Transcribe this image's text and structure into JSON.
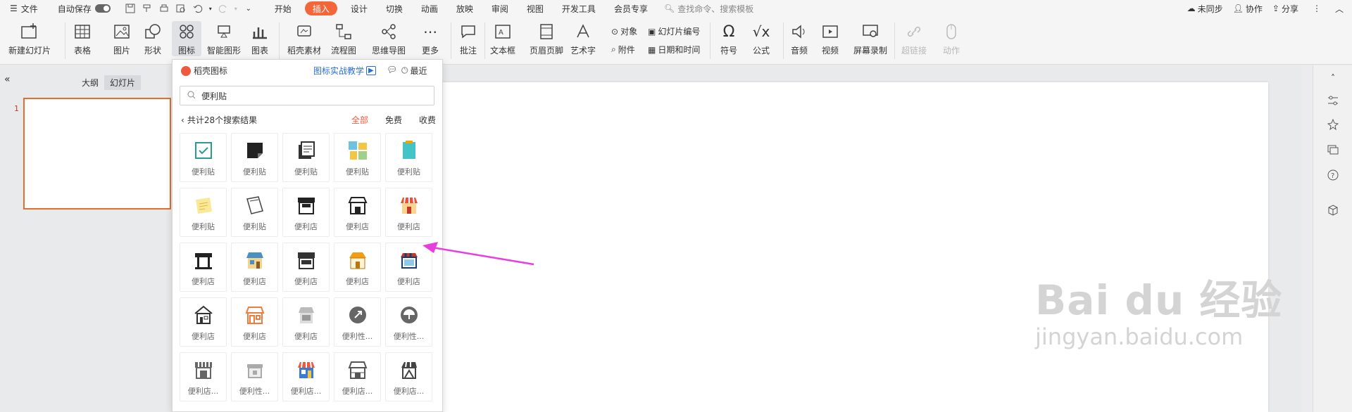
{
  "menubar": {
    "file_label": "文件",
    "autosave_label": "自动保存",
    "tabs": [
      "开始",
      "插入",
      "设计",
      "切换",
      "动画",
      "放映",
      "审阅",
      "视图",
      "开发工具",
      "会员专享"
    ],
    "active_tab": "插入",
    "search_placeholder": "查找命令、搜索模板",
    "sync_label": "未同步",
    "collab_label": "协作",
    "share_label": "分享"
  },
  "ribbon": {
    "new_slide": "新建幻灯片",
    "table": "表格",
    "picture": "图片",
    "shape": "形状",
    "icon": "图标",
    "smartart": "智能图形",
    "chart": "图表",
    "material": "稻壳素材",
    "flowchart": "流程图",
    "mindmap": "思维导图",
    "more": "更多",
    "comment": "批注",
    "textbox": "文本框",
    "header_footer": "页眉页脚",
    "wordart": "艺术字",
    "object": "对象",
    "slide_number": "幻灯片编号",
    "attachment": "附件",
    "date_time": "日期和时间",
    "symbol": "符号",
    "formula": "公式",
    "audio": "音频",
    "video": "视频",
    "screen_record": "屏幕录制",
    "hyperlink": "超链接",
    "action": "动作"
  },
  "leftpane": {
    "outline_tab": "大纲",
    "slides_tab": "幻灯片",
    "slide_number": "1"
  },
  "panel": {
    "title": "稻壳图标",
    "tutorial_link": "图标实战教学",
    "recent": "最近",
    "search_value": "便利贴",
    "result_count": "共计28个搜索结果",
    "filters": [
      "全部",
      "免费",
      "收费"
    ],
    "items": [
      {
        "name": "便利贴",
        "icon": "sticky-note-check-icon"
      },
      {
        "name": "便利贴",
        "icon": "sticky-note-black-icon"
      },
      {
        "name": "便利贴",
        "icon": "sticky-note-stack-icon"
      },
      {
        "name": "便利贴",
        "icon": "sticky-notes-board-icon"
      },
      {
        "name": "便利贴",
        "icon": "sticky-note-teal-icon"
      },
      {
        "name": "便利贴",
        "icon": "sticky-note-yellow-icon"
      },
      {
        "name": "便利贴",
        "icon": "sticky-note-outline-icon"
      },
      {
        "name": "便利店",
        "icon": "store-open-icon"
      },
      {
        "name": "便利店",
        "icon": "store-outline-icon"
      },
      {
        "name": "便利店",
        "icon": "store-red-awning-icon"
      },
      {
        "name": "便利店",
        "icon": "store-black-icon"
      },
      {
        "name": "便利店",
        "icon": "store-blue-icon"
      },
      {
        "name": "便利店",
        "icon": "store-dark-icon"
      },
      {
        "name": "便利店",
        "icon": "store-orange-icon"
      },
      {
        "name": "便利店",
        "icon": "store-window-icon"
      },
      {
        "name": "便利店",
        "icon": "store-house-icon"
      },
      {
        "name": "便利店",
        "icon": "store-orange-outline-icon"
      },
      {
        "name": "便利店",
        "icon": "store-gray-icon"
      },
      {
        "name": "便利性...",
        "icon": "rocket-circle-icon"
      },
      {
        "name": "便利性...",
        "icon": "umbrella-circle-icon"
      },
      {
        "name": "便利店...",
        "icon": "store-striped-icon"
      },
      {
        "name": "便利性...",
        "icon": "store-gray-small-icon"
      },
      {
        "name": "便利店...",
        "icon": "store-colorful-icon"
      },
      {
        "name": "便利店...",
        "icon": "store-line-icon"
      },
      {
        "name": "便利店...",
        "icon": "store-tilted-icon"
      }
    ]
  },
  "watermark": {
    "brand": "Bai du 经验",
    "url": "jingyan.baidu.com"
  },
  "colors": {
    "accent": "#f4663a",
    "link": "#2a6fd6",
    "arrow": "#e83ee0",
    "thumb_border": "#e0702c"
  }
}
